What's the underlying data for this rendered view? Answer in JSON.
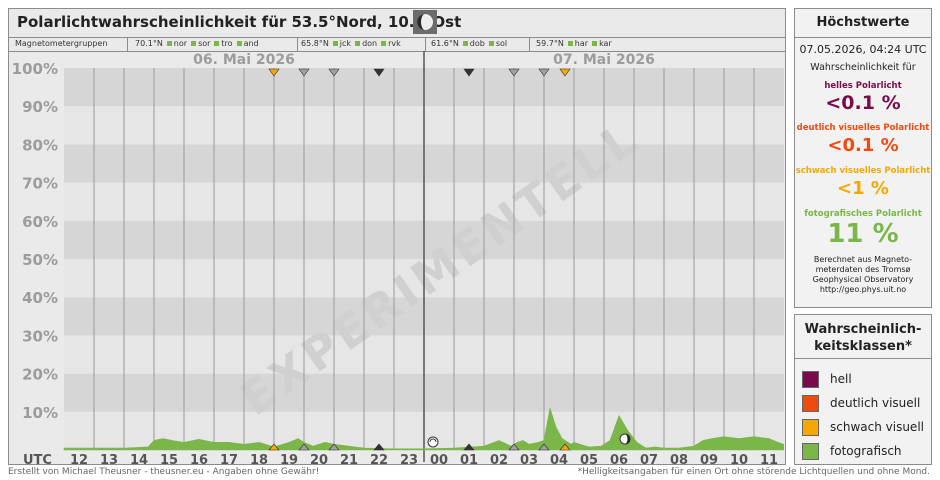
{
  "header": {
    "title": "Polarlichtwahrscheinlichkeit für 53.5°Nord, 10.0°Ost",
    "moon_icon": "moon-phase-icon"
  },
  "groups": {
    "label": "Magnetometergruppen",
    "items": [
      {
        "lat": "70.1°N",
        "stations": [
          "nor",
          "sor",
          "tro",
          "and"
        ]
      },
      {
        "lat": "65.8°N",
        "stations": [
          "jck",
          "don",
          "rvk"
        ]
      },
      {
        "lat": "61.6°N",
        "stations": [
          "dob",
          "sol"
        ]
      },
      {
        "lat": "59.7°N",
        "stations": [
          "har",
          "kar"
        ]
      }
    ]
  },
  "chart_data": {
    "type": "area",
    "x_unit": "UTC hour",
    "xlabel": "UTC",
    "date_labels": [
      "06. Mai 2026",
      "07. Mai 2026"
    ],
    "x_tick_labels": [
      "12",
      "13",
      "14",
      "15",
      "16",
      "17",
      "18",
      "19",
      "20",
      "21",
      "22",
      "23",
      "00",
      "01",
      "02",
      "03",
      "04",
      "05",
      "06",
      "07",
      "08",
      "09",
      "10",
      "11"
    ],
    "y_tick_labels": [
      "10%",
      "20%",
      "30%",
      "40%",
      "50%",
      "60%",
      "70%",
      "80%",
      "90%",
      "100%"
    ],
    "ylim": [
      0,
      100
    ],
    "watermark": "EXPERIMENTELL",
    "series": [
      {
        "name": "fotografisch",
        "color": "#7ab648",
        "x": [
          12.0,
          13.0,
          14.0,
          14.8,
          15.0,
          15.3,
          15.6,
          16.0,
          16.5,
          17.0,
          17.5,
          18.0,
          18.5,
          19.0,
          19.5,
          19.8,
          20.0,
          20.3,
          20.7,
          21.0,
          21.5,
          22.0,
          23.0,
          24.0,
          25.0,
          26.0,
          26.5,
          26.9,
          27.1,
          27.3,
          27.5,
          27.8,
          28.0,
          28.2,
          28.4,
          28.6,
          28.9,
          29.0,
          29.2,
          29.5,
          29.9,
          30.2,
          30.5,
          30.8,
          31.1,
          31.4,
          31.7,
          32.0,
          32.5,
          33.0,
          33.3,
          33.6,
          34.0,
          34.5,
          35.0,
          35.5,
          35.8,
          35.99
        ],
        "y": [
          0.5,
          0.5,
          0.5,
          0.8,
          2.5,
          3.0,
          2.5,
          2.0,
          2.8,
          2.0,
          2.0,
          1.5,
          2.0,
          0.8,
          2.0,
          3.0,
          2.0,
          1.0,
          2.0,
          1.5,
          1.0,
          0.5,
          0.3,
          0.3,
          0.5,
          1.0,
          2.5,
          1.0,
          2.0,
          2.5,
          1.5,
          2.0,
          2.5,
          11.0,
          6.0,
          3.0,
          1.5,
          2.0,
          1.5,
          0.8,
          1.0,
          2.5,
          9.0,
          5.0,
          2.0,
          0.5,
          0.8,
          0.5,
          0.5,
          1.0,
          2.5,
          3.0,
          3.5,
          3.0,
          3.5,
          3.0,
          2.0,
          1.5
        ]
      }
    ],
    "markers": [
      {
        "x": 19.0,
        "level": "schwach",
        "color": "#f6a800"
      },
      {
        "x": 20.0,
        "level": "gering",
        "color": "#a0a0a0"
      },
      {
        "x": 21.0,
        "level": "gering",
        "color": "#a0a0a0"
      },
      {
        "x": 22.5,
        "level": "stark",
        "color": "#333333"
      },
      {
        "x": 25.5,
        "level": "stark",
        "color": "#333333"
      },
      {
        "x": 27.0,
        "level": "gering",
        "color": "#a0a0a0"
      },
      {
        "x": 28.0,
        "level": "gering",
        "color": "#a0a0a0"
      },
      {
        "x": 28.7,
        "level": "schwach",
        "color": "#f6a800"
      }
    ],
    "bottom_markers": [
      {
        "x": 19.0,
        "color": "#f6a800"
      },
      {
        "x": 20.0,
        "color": "#a0a0a0"
      },
      {
        "x": 21.0,
        "color": "#a0a0a0"
      },
      {
        "x": 22.5,
        "color": "#333333"
      },
      {
        "x": 25.5,
        "color": "#333333"
      },
      {
        "x": 27.0,
        "color": "#a0a0a0"
      },
      {
        "x": 28.0,
        "color": "#a0a0a0"
      },
      {
        "x": 28.7,
        "color": "#f6a800"
      }
    ],
    "sun_icon_x": 24.3,
    "moon_icon_x": 30.7
  },
  "max_panel": {
    "title": "Höchstwerte",
    "timestamp": "07.05.2026, 04:24 UTC",
    "intro": "Wahrscheinlichkeit für",
    "classes": [
      {
        "label": "helles Polarlicht",
        "value": "<0.1 %",
        "color": "#7a0a4a"
      },
      {
        "label": "deutlich visuelles Polarlicht",
        "value": "<0.1 %",
        "color": "#f04a10"
      },
      {
        "label": "schwach visuelles Polarlicht",
        "value": "<1 %",
        "color": "#f6a800"
      },
      {
        "label": "fotografisches Polarlicht",
        "value": "11 %",
        "color": "#7ab648"
      }
    ],
    "source_lines": [
      "Berechnet aus Magneto-",
      "meterdaten des Tromsø",
      "Geophysical Observatory",
      "http://geo.phys.uit.no"
    ]
  },
  "legend": {
    "title_lines": [
      "Wahrscheinlich-",
      "keitsklassen*"
    ],
    "items": [
      {
        "label": "hell",
        "color": "#7a0a4a"
      },
      {
        "label": "deutlich visuell",
        "color": "#f04a10"
      },
      {
        "label": "schwach visuell",
        "color": "#f6a800"
      },
      {
        "label": "fotografisch",
        "color": "#7ab648"
      }
    ]
  },
  "footer": {
    "left": "Erstellt von Michael Theusner - theusner.eu - Angaben ohne Gewähr!",
    "right": "*Helligkeitsangaben für einen Ort ohne störende Lichtquellen und ohne Mond."
  }
}
